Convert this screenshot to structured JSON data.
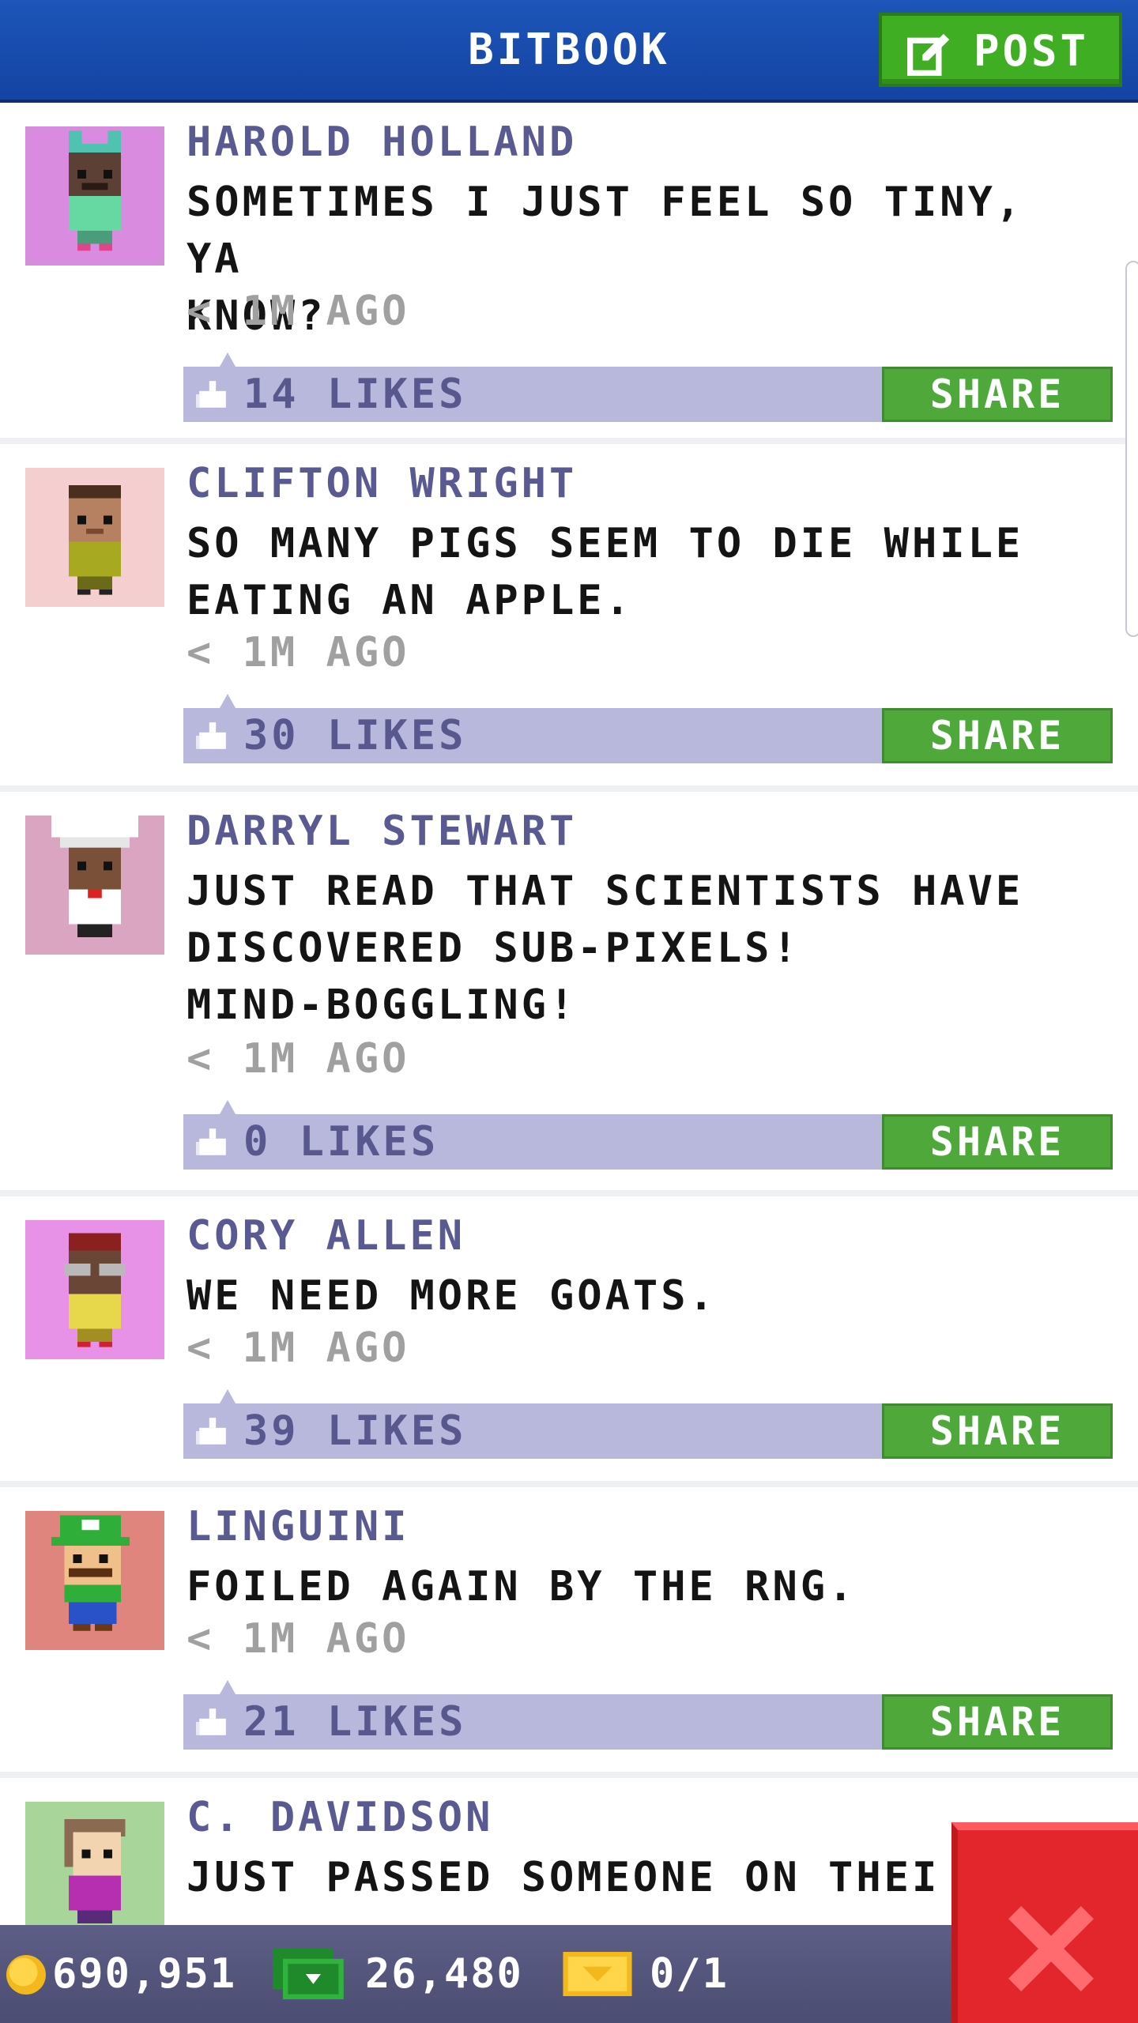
{
  "header": {
    "title": "BITBOOK",
    "post_label": "POST"
  },
  "posts": [
    {
      "author": "HAROLD HOLLAND",
      "text": "SOMETIMES I JUST FEEL SO TINY, YA\nKNOW?",
      "time": "< 1M AGO",
      "likes": "14 LIKES",
      "share": "SHARE",
      "avatar_bg": "#d98be0"
    },
    {
      "author": "CLIFTON WRIGHT",
      "text": "SO MANY PIGS SEEM TO DIE WHILE\nEATING AN APPLE.",
      "time": "< 1M AGO",
      "likes": "30 LIKES",
      "share": "SHARE",
      "avatar_bg": "#f5cfcf"
    },
    {
      "author": "DARRYL STEWART",
      "text": "JUST READ THAT SCIENTISTS HAVE\nDISCOVERED SUB-PIXELS!\nMIND-BOGGLING!",
      "time": "< 1M AGO",
      "likes": "0 LIKES",
      "share": "SHARE",
      "avatar_bg": "#d9a5c0"
    },
    {
      "author": "CORY ALLEN",
      "text": "WE NEED MORE GOATS.",
      "time": "< 1M AGO",
      "likes": "39 LIKES",
      "share": "SHARE",
      "avatar_bg": "#e792e6"
    },
    {
      "author": "LINGUINI",
      "text": "FOILED AGAIN BY THE RNG.",
      "time": "< 1M AGO",
      "likes": "21 LIKES",
      "share": "SHARE",
      "avatar_bg": "#e0857e"
    },
    {
      "author": "C. DAVIDSON",
      "text": "JUST PASSED SOMEONE ON THEI",
      "avatar_bg": "#a8d59a"
    }
  ],
  "status_bar": {
    "coins": "690,951",
    "bux": "26,480",
    "tickets": "0/1"
  },
  "colors": {
    "header_blue": "#1c56b8",
    "post_green": "#3fae23",
    "like_bar": "#b8b8dc",
    "close_red": "#e2262b"
  }
}
